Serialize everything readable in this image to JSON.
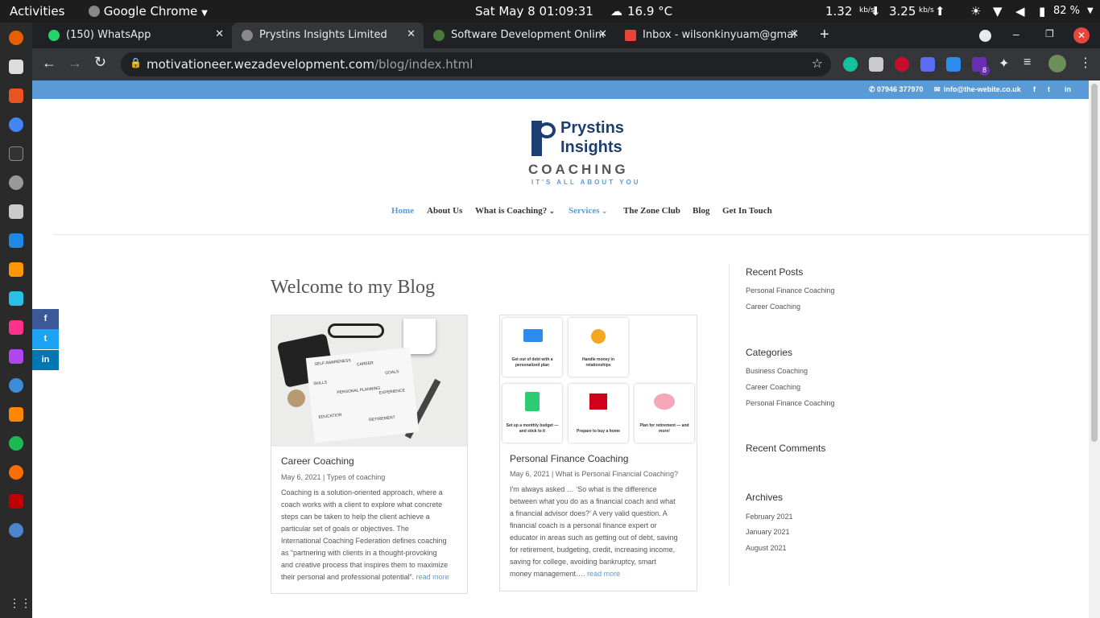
{
  "system": {
    "activities": "Activities",
    "app_name": "Google Chrome",
    "datetime": "Sat May 8  01:09:31",
    "weather": "16.9 °C",
    "down_speed": "1.32",
    "up_speed": "3.25",
    "speed_unit": "kb/s",
    "battery": "82 %"
  },
  "browser": {
    "tabs": [
      {
        "title": "(150) WhatsApp",
        "active": false
      },
      {
        "title": "Prystins Insights Limited",
        "active": true
      },
      {
        "title": "Software Development Online |",
        "active": false
      },
      {
        "title": "Inbox - wilsonkinyuam@gmail.co",
        "active": false
      }
    ],
    "url_host": "motivationeer.wezadevelopment.com",
    "url_path": "/blog/index.html",
    "ext_badge": "8"
  },
  "topbar": {
    "phone": "07946 377970",
    "email": "info@the-webite.co.uk"
  },
  "logo": {
    "line1": "Prystins",
    "line2": "Insights",
    "line3": "COACHING",
    "tagline": "IT'S ALL ABOUT YOU"
  },
  "nav": [
    {
      "label": "Home",
      "active": true
    },
    {
      "label": "About Us"
    },
    {
      "label": "What is Coaching?",
      "dropdown": true
    },
    {
      "label": "Services",
      "dropdown": true,
      "active": true
    },
    {
      "label": "The Zone Club"
    },
    {
      "label": "Blog"
    },
    {
      "label": "Get In Touch"
    }
  ],
  "page_title": "Welcome to my Blog",
  "posts": [
    {
      "title": "Career Coaching",
      "date": "May 6, 2021",
      "category": "Types of coaching",
      "excerpt": [
        "Coaching is a solution-oriented approach, where a",
        "coach works with a client to explore what concrete",
        "steps can be taken to help the client achieve a",
        "particular set of goals or objectives. The",
        "International Coaching Federation defines coaching",
        "as “partnering with clients in a thought-provoking",
        "and creative process that inspires them to maximize",
        "their personal and professional potential”."
      ],
      "image_labels": [
        "SELF AWARENESS",
        "CAREER",
        "GOALS",
        "PERSONAL PLANNING",
        "EXPERIENCE",
        "EDUCATION",
        "RETIREMENT",
        "SKILLS"
      ],
      "read_more": "read more"
    },
    {
      "title": "Personal Finance Coaching",
      "date": "May 6, 2021",
      "category": "What is Personal Financial Coaching?",
      "excerpt": [
        "I'm always asked … ‘So what is the difference",
        "between what you do as a financial coach and what",
        "a financial advisor does?’ A very valid question. A",
        "financial coach is a personal finance expert or",
        "educator in areas such as getting out of debt, saving",
        "for retirement, budgeting, credit, increasing income,",
        "saving for college, avoiding bankruptcy, smart",
        "money management…."
      ],
      "tiles": [
        "Get out of debt with a personalized plan",
        "Handle money in relationships",
        "Set up a monthly budget — and stick to it",
        "Prepare to buy a home",
        "Plan for retirement — and more!"
      ],
      "read_more": "read more"
    }
  ],
  "sidebar": {
    "recent_posts_title": "Recent Posts",
    "recent_posts": [
      "Personal Finance Coaching",
      "Career Coaching"
    ],
    "categories_title": "Categories",
    "categories": [
      "Business Coaching",
      "Career Coaching",
      "Personal Finance Coaching"
    ],
    "recent_comments_title": "Recent Comments",
    "archives_title": "Archives",
    "archives": [
      "February 2021",
      "January 2021",
      "August 2021"
    ]
  },
  "colors": {
    "accent": "#5b9bd5",
    "facebook": "#3b5998",
    "twitter": "#1da1f2",
    "linkedin": "#0077b5"
  }
}
